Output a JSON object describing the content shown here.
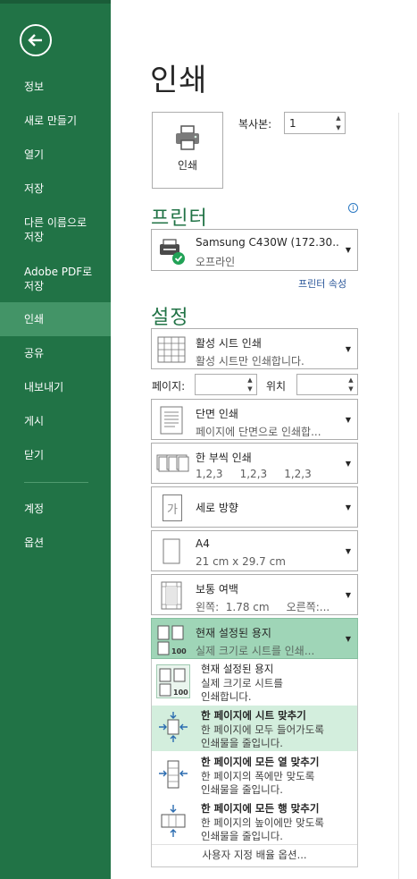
{
  "sidebar": {
    "items": [
      {
        "label": "정보"
      },
      {
        "label": "새로 만들기"
      },
      {
        "label": "열기"
      },
      {
        "label": "저장"
      },
      {
        "label": "다른 이름으로\n저장"
      },
      {
        "label": "Adobe PDF로\n저장"
      },
      {
        "label": "인쇄"
      },
      {
        "label": "공유"
      },
      {
        "label": "내보내기"
      },
      {
        "label": "게시"
      },
      {
        "label": "닫기"
      },
      {
        "label": "계정"
      },
      {
        "label": "옵션"
      }
    ]
  },
  "page": {
    "title": "인쇄"
  },
  "print_button": {
    "label": "인쇄"
  },
  "copies": {
    "label": "복사본:",
    "value": "1"
  },
  "printer": {
    "section": "프린터",
    "name": "Samsung C430W (172.30....",
    "status": "오프라인",
    "properties_link": "프린터 속성"
  },
  "settings": {
    "section": "설정",
    "what": {
      "title": "활성 시트 인쇄",
      "sub": "활성 시트만 인쇄합니다."
    },
    "pages_label": "페이지:",
    "to_label": "위치",
    "sides": {
      "title": "단면 인쇄",
      "sub": "페이지에 단면으로 인쇄합..."
    },
    "collate": {
      "title": "한 부씩 인쇄",
      "sub": "1,2,3     1,2,3     1,2,3"
    },
    "orientation": {
      "title": "세로 방향",
      "icon_text": "가"
    },
    "paper": {
      "title": "A4",
      "sub": "21 cm x 29.7 cm"
    },
    "margins": {
      "title": "보통 여백",
      "sub": "왼쪽:  1.78 cm     오른쪽:..."
    },
    "scaling": {
      "title": "현재 설정된 용지",
      "sub": "실제 크기로 시트를 인쇄..."
    }
  },
  "scaling_options": [
    {
      "title": "현재 설정된 용지",
      "line1": "실제 크기로 시트를",
      "line2": "인쇄합니다."
    },
    {
      "title": "한 페이지에 시트 맞추기",
      "line1": "한 페이지에 모두 들어가도록",
      "line2": "인쇄물을 줄입니다."
    },
    {
      "title": "한 페이지에 모든 열 맞추기",
      "line1": "한 페이지의 폭에만 맞도록",
      "line2": "인쇄물을 줄입니다."
    },
    {
      "title": "한 페이지에 모든 행 맞추기",
      "line1": "한 페이지의 높이에만 맞도록",
      "line2": "인쇄물을 줄입니다."
    }
  ],
  "custom_scaling": "사용자 지정 배율 옵션...",
  "icon_text": {
    "scale_100": "100"
  },
  "colors": {
    "sidebar": "#217346",
    "active": "#439467",
    "accent": "#217346",
    "selected": "#9fd5b7",
    "highlight": "#d3eedd"
  }
}
